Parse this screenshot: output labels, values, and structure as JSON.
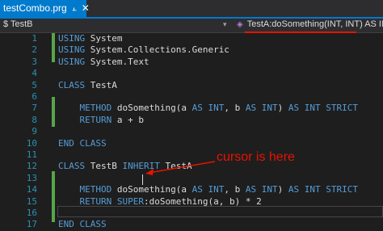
{
  "tab": {
    "title": "testCombo.prg",
    "pin_icon": "pin-icon",
    "close_icon": "close-icon"
  },
  "navbar": {
    "class_dropdown": "$ TestB",
    "member_dropdown": "TestA:doSomething(INT, INT) AS INT"
  },
  "annotation": {
    "text": "cursor is here"
  },
  "code": {
    "lines": [
      {
        "n": "1",
        "parts": [
          [
            "k",
            "USING"
          ],
          [
            "t",
            " System"
          ]
        ]
      },
      {
        "n": "2",
        "parts": [
          [
            "k",
            "USING"
          ],
          [
            "t",
            " System.Collections.Generic"
          ]
        ]
      },
      {
        "n": "3",
        "parts": [
          [
            "k",
            "USING"
          ],
          [
            "t",
            " System.Text"
          ]
        ]
      },
      {
        "n": "4",
        "parts": []
      },
      {
        "n": "5",
        "parts": [
          [
            "k",
            "CLASS"
          ],
          [
            "t",
            " TestA"
          ]
        ]
      },
      {
        "n": "6",
        "parts": []
      },
      {
        "n": "7",
        "parts": [
          [
            "t",
            "    "
          ],
          [
            "k",
            "METHOD"
          ],
          [
            "t",
            " doSomething(a "
          ],
          [
            "k",
            "AS"
          ],
          [
            "t",
            " "
          ],
          [
            "k",
            "INT"
          ],
          [
            "t",
            ", b "
          ],
          [
            "k",
            "AS"
          ],
          [
            "t",
            " "
          ],
          [
            "k",
            "INT"
          ],
          [
            "t",
            ") "
          ],
          [
            "k",
            "AS"
          ],
          [
            "t",
            " "
          ],
          [
            "k",
            "INT"
          ],
          [
            "t",
            " "
          ],
          [
            "k",
            "STRICT"
          ]
        ]
      },
      {
        "n": "8",
        "parts": [
          [
            "t",
            "    "
          ],
          [
            "k",
            "RETURN"
          ],
          [
            "t",
            " a + b"
          ]
        ]
      },
      {
        "n": "9",
        "parts": []
      },
      {
        "n": "10",
        "parts": [
          [
            "k",
            "END CLASS"
          ]
        ]
      },
      {
        "n": "11",
        "parts": []
      },
      {
        "n": "12",
        "parts": [
          [
            "k",
            "CLASS"
          ],
          [
            "t",
            " TestB "
          ],
          [
            "k",
            "INHERIT"
          ],
          [
            "t",
            " TestA"
          ]
        ]
      },
      {
        "n": "13",
        "parts": []
      },
      {
        "n": "14",
        "parts": [
          [
            "t",
            "    "
          ],
          [
            "k",
            "METHOD"
          ],
          [
            "t",
            " doSomething(a "
          ],
          [
            "k",
            "AS"
          ],
          [
            "t",
            " "
          ],
          [
            "k",
            "INT"
          ],
          [
            "t",
            ", b "
          ],
          [
            "k",
            "AS"
          ],
          [
            "t",
            " "
          ],
          [
            "k",
            "INT"
          ],
          [
            "t",
            ") "
          ],
          [
            "k",
            "AS"
          ],
          [
            "t",
            " "
          ],
          [
            "k",
            "INT"
          ],
          [
            "t",
            " "
          ],
          [
            "k",
            "STRICT"
          ]
        ]
      },
      {
        "n": "15",
        "parts": [
          [
            "t",
            "    "
          ],
          [
            "k",
            "RETURN"
          ],
          [
            "t",
            " "
          ],
          [
            "k",
            "SUPER"
          ],
          [
            "t",
            ":doSomething(a, b) * 2"
          ]
        ]
      },
      {
        "n": "16",
        "parts": []
      },
      {
        "n": "17",
        "parts": [
          [
            "k",
            "END CLASS"
          ]
        ]
      }
    ]
  },
  "colors": {
    "accent": "#007acc",
    "keyword": "#569cd6",
    "text": "#dcdcdc",
    "line_number": "#2b91af",
    "changed_margin": "#57a64a",
    "annotation": "#e51400"
  }
}
